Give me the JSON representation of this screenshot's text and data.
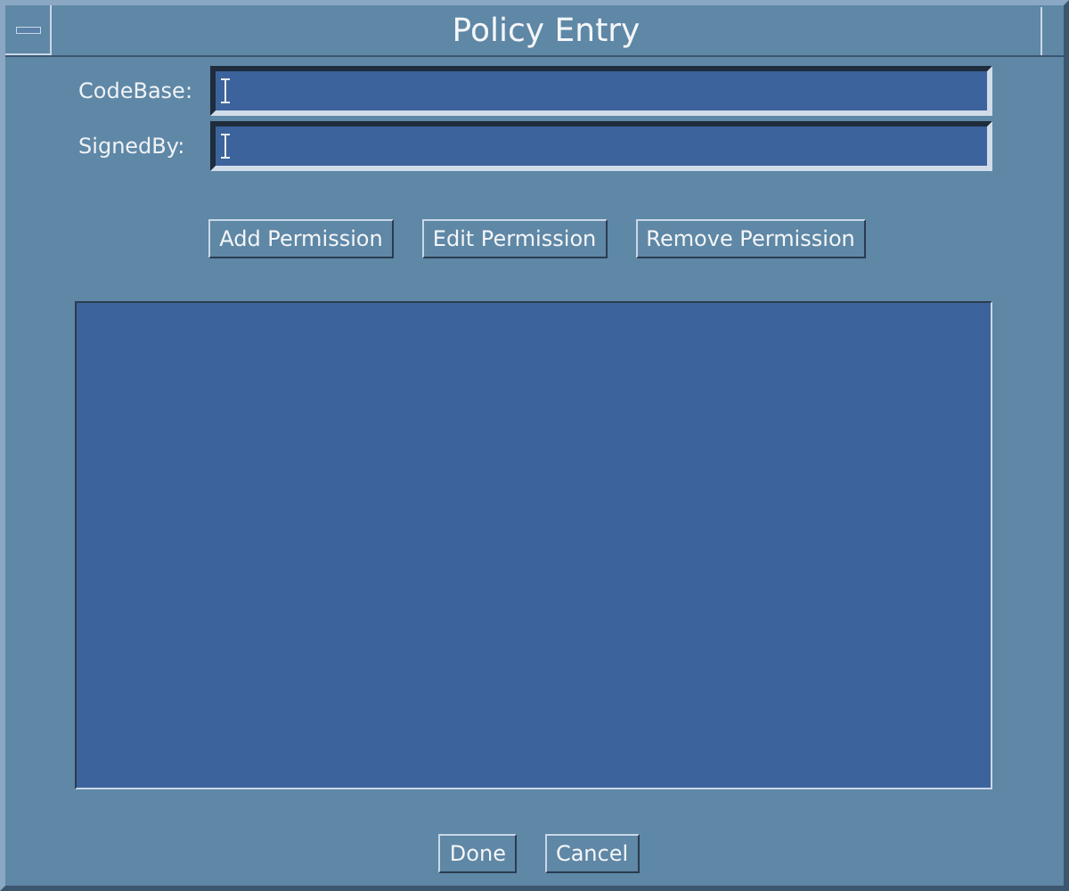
{
  "window": {
    "title": "Policy Entry"
  },
  "fields": [
    {
      "label": "CodeBase:"
    },
    {
      "label": "SignedBy:"
    }
  ],
  "buttons": [
    "Add Permission",
    "Edit Permission",
    "Remove Permission"
  ],
  "footer_buttons": [
    "Done",
    "Cancel"
  ]
}
